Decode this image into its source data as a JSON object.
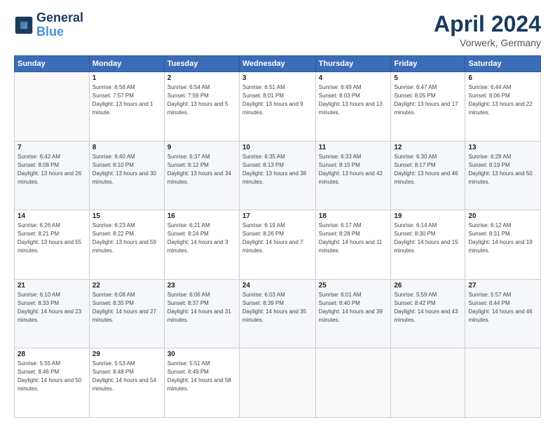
{
  "header": {
    "logo_line1": "General",
    "logo_line2": "Blue",
    "month": "April 2024",
    "location": "Vorwerk, Germany"
  },
  "weekdays": [
    "Sunday",
    "Monday",
    "Tuesday",
    "Wednesday",
    "Thursday",
    "Friday",
    "Saturday"
  ],
  "weeks": [
    [
      {
        "day": "",
        "sunrise": "",
        "sunset": "",
        "daylight": ""
      },
      {
        "day": "1",
        "sunrise": "Sunrise: 6:56 AM",
        "sunset": "Sunset: 7:57 PM",
        "daylight": "Daylight: 13 hours and 1 minute."
      },
      {
        "day": "2",
        "sunrise": "Sunrise: 6:54 AM",
        "sunset": "Sunset: 7:59 PM",
        "daylight": "Daylight: 13 hours and 5 minutes."
      },
      {
        "day": "3",
        "sunrise": "Sunrise: 6:51 AM",
        "sunset": "Sunset: 8:01 PM",
        "daylight": "Daylight: 13 hours and 9 minutes."
      },
      {
        "day": "4",
        "sunrise": "Sunrise: 6:49 AM",
        "sunset": "Sunset: 8:03 PM",
        "daylight": "Daylight: 13 hours and 13 minutes."
      },
      {
        "day": "5",
        "sunrise": "Sunrise: 6:47 AM",
        "sunset": "Sunset: 8:05 PM",
        "daylight": "Daylight: 13 hours and 17 minutes."
      },
      {
        "day": "6",
        "sunrise": "Sunrise: 6:44 AM",
        "sunset": "Sunset: 8:06 PM",
        "daylight": "Daylight: 13 hours and 22 minutes."
      }
    ],
    [
      {
        "day": "7",
        "sunrise": "Sunrise: 6:42 AM",
        "sunset": "Sunset: 8:08 PM",
        "daylight": "Daylight: 13 hours and 26 minutes."
      },
      {
        "day": "8",
        "sunrise": "Sunrise: 6:40 AM",
        "sunset": "Sunset: 8:10 PM",
        "daylight": "Daylight: 13 hours and 30 minutes."
      },
      {
        "day": "9",
        "sunrise": "Sunrise: 6:37 AM",
        "sunset": "Sunset: 8:12 PM",
        "daylight": "Daylight: 13 hours and 34 minutes."
      },
      {
        "day": "10",
        "sunrise": "Sunrise: 6:35 AM",
        "sunset": "Sunset: 8:13 PM",
        "daylight": "Daylight: 13 hours and 38 minutes."
      },
      {
        "day": "11",
        "sunrise": "Sunrise: 6:33 AM",
        "sunset": "Sunset: 8:15 PM",
        "daylight": "Daylight: 13 hours and 42 minutes."
      },
      {
        "day": "12",
        "sunrise": "Sunrise: 6:30 AM",
        "sunset": "Sunset: 8:17 PM",
        "daylight": "Daylight: 13 hours and 46 minutes."
      },
      {
        "day": "13",
        "sunrise": "Sunrise: 6:28 AM",
        "sunset": "Sunset: 8:19 PM",
        "daylight": "Daylight: 13 hours and 50 minutes."
      }
    ],
    [
      {
        "day": "14",
        "sunrise": "Sunrise: 6:26 AM",
        "sunset": "Sunset: 8:21 PM",
        "daylight": "Daylight: 13 hours and 55 minutes."
      },
      {
        "day": "15",
        "sunrise": "Sunrise: 6:23 AM",
        "sunset": "Sunset: 8:22 PM",
        "daylight": "Daylight: 13 hours and 59 minutes."
      },
      {
        "day": "16",
        "sunrise": "Sunrise: 6:21 AM",
        "sunset": "Sunset: 8:24 PM",
        "daylight": "Daylight: 14 hours and 3 minutes."
      },
      {
        "day": "17",
        "sunrise": "Sunrise: 6:19 AM",
        "sunset": "Sunset: 8:26 PM",
        "daylight": "Daylight: 14 hours and 7 minutes."
      },
      {
        "day": "18",
        "sunrise": "Sunrise: 6:17 AM",
        "sunset": "Sunset: 8:28 PM",
        "daylight": "Daylight: 14 hours and 11 minutes."
      },
      {
        "day": "19",
        "sunrise": "Sunrise: 6:14 AM",
        "sunset": "Sunset: 8:30 PM",
        "daylight": "Daylight: 14 hours and 15 minutes."
      },
      {
        "day": "20",
        "sunrise": "Sunrise: 6:12 AM",
        "sunset": "Sunset: 8:31 PM",
        "daylight": "Daylight: 14 hours and 19 minutes."
      }
    ],
    [
      {
        "day": "21",
        "sunrise": "Sunrise: 6:10 AM",
        "sunset": "Sunset: 8:33 PM",
        "daylight": "Daylight: 14 hours and 23 minutes."
      },
      {
        "day": "22",
        "sunrise": "Sunrise: 6:08 AM",
        "sunset": "Sunset: 8:35 PM",
        "daylight": "Daylight: 14 hours and 27 minutes."
      },
      {
        "day": "23",
        "sunrise": "Sunrise: 6:06 AM",
        "sunset": "Sunset: 8:37 PM",
        "daylight": "Daylight: 14 hours and 31 minutes."
      },
      {
        "day": "24",
        "sunrise": "Sunrise: 6:03 AM",
        "sunset": "Sunset: 8:39 PM",
        "daylight": "Daylight: 14 hours and 35 minutes."
      },
      {
        "day": "25",
        "sunrise": "Sunrise: 6:01 AM",
        "sunset": "Sunset: 8:40 PM",
        "daylight": "Daylight: 14 hours and 39 minutes."
      },
      {
        "day": "26",
        "sunrise": "Sunrise: 5:59 AM",
        "sunset": "Sunset: 8:42 PM",
        "daylight": "Daylight: 14 hours and 43 minutes."
      },
      {
        "day": "27",
        "sunrise": "Sunrise: 5:57 AM",
        "sunset": "Sunset: 8:44 PM",
        "daylight": "Daylight: 14 hours and 46 minutes."
      }
    ],
    [
      {
        "day": "28",
        "sunrise": "Sunrise: 5:55 AM",
        "sunset": "Sunset: 8:46 PM",
        "daylight": "Daylight: 14 hours and 50 minutes."
      },
      {
        "day": "29",
        "sunrise": "Sunrise: 5:53 AM",
        "sunset": "Sunset: 8:48 PM",
        "daylight": "Daylight: 14 hours and 54 minutes."
      },
      {
        "day": "30",
        "sunrise": "Sunrise: 5:51 AM",
        "sunset": "Sunset: 8:49 PM",
        "daylight": "Daylight: 14 hours and 58 minutes."
      },
      {
        "day": "",
        "sunrise": "",
        "sunset": "",
        "daylight": ""
      },
      {
        "day": "",
        "sunrise": "",
        "sunset": "",
        "daylight": ""
      },
      {
        "day": "",
        "sunrise": "",
        "sunset": "",
        "daylight": ""
      },
      {
        "day": "",
        "sunrise": "",
        "sunset": "",
        "daylight": ""
      }
    ]
  ]
}
